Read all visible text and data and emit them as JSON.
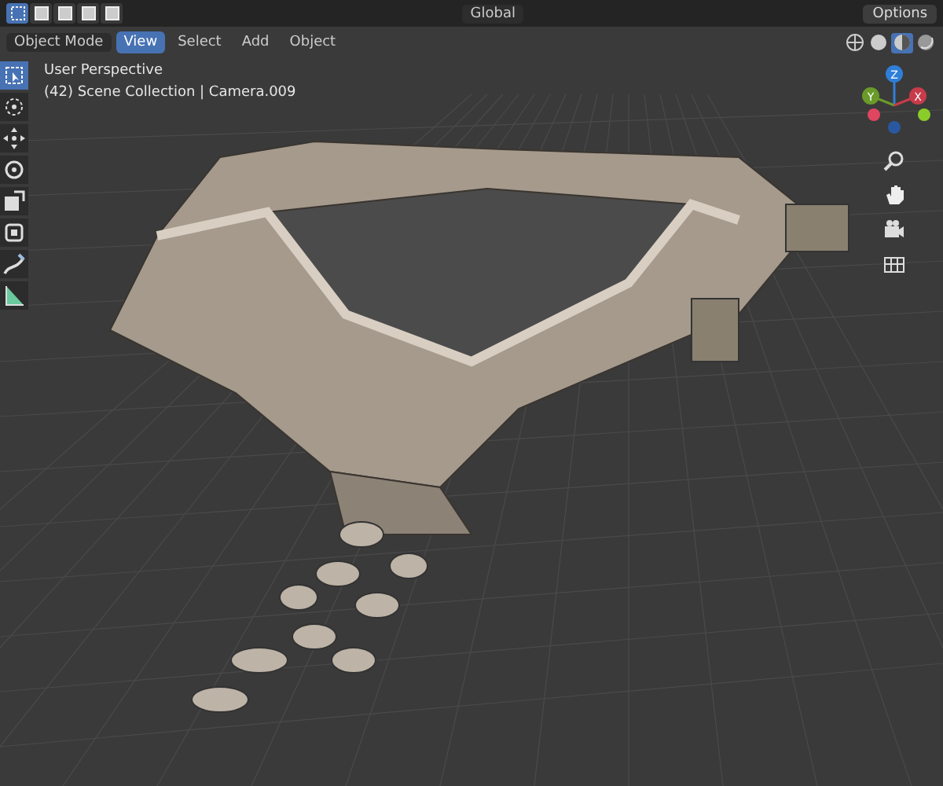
{
  "top_bar": {
    "select_modes": [
      {
        "selected": true
      },
      {
        "selected": false
      },
      {
        "selected": false
      },
      {
        "selected": false
      },
      {
        "selected": false
      }
    ],
    "orientation": "Global",
    "options": "Options"
  },
  "header": {
    "mode": "Object Mode",
    "menus": [
      {
        "label": "View",
        "selected": true
      },
      {
        "label": "Select",
        "selected": false
      },
      {
        "label": "Add",
        "selected": false
      },
      {
        "label": "Object",
        "selected": false
      }
    ],
    "shading": [
      {
        "kind": "wire",
        "selected": false
      },
      {
        "kind": "solid",
        "selected": false
      },
      {
        "kind": "material",
        "selected": true
      },
      {
        "kind": "rendered",
        "selected": false
      }
    ]
  },
  "viewport": {
    "view_name": "User Perspective",
    "collection_info": "(42) Scene Collection | Camera.009"
  },
  "toolbar": [
    {
      "kind": "select",
      "selected": true
    },
    {
      "kind": "cursor",
      "selected": false
    },
    {
      "kind": "move",
      "selected": false
    },
    {
      "kind": "rotate",
      "selected": false
    },
    {
      "kind": "scale",
      "selected": false
    },
    {
      "kind": "transform",
      "selected": false
    },
    {
      "kind": "annotate",
      "selected": false
    },
    {
      "kind": "measure",
      "selected": false
    }
  ],
  "gizmo": {
    "axes": [
      {
        "label": "Z",
        "color": "#2f7fd9"
      },
      {
        "label": "Y",
        "color": "#6a9a2a"
      },
      {
        "label": "X",
        "color": "#c83b4a"
      }
    ]
  }
}
